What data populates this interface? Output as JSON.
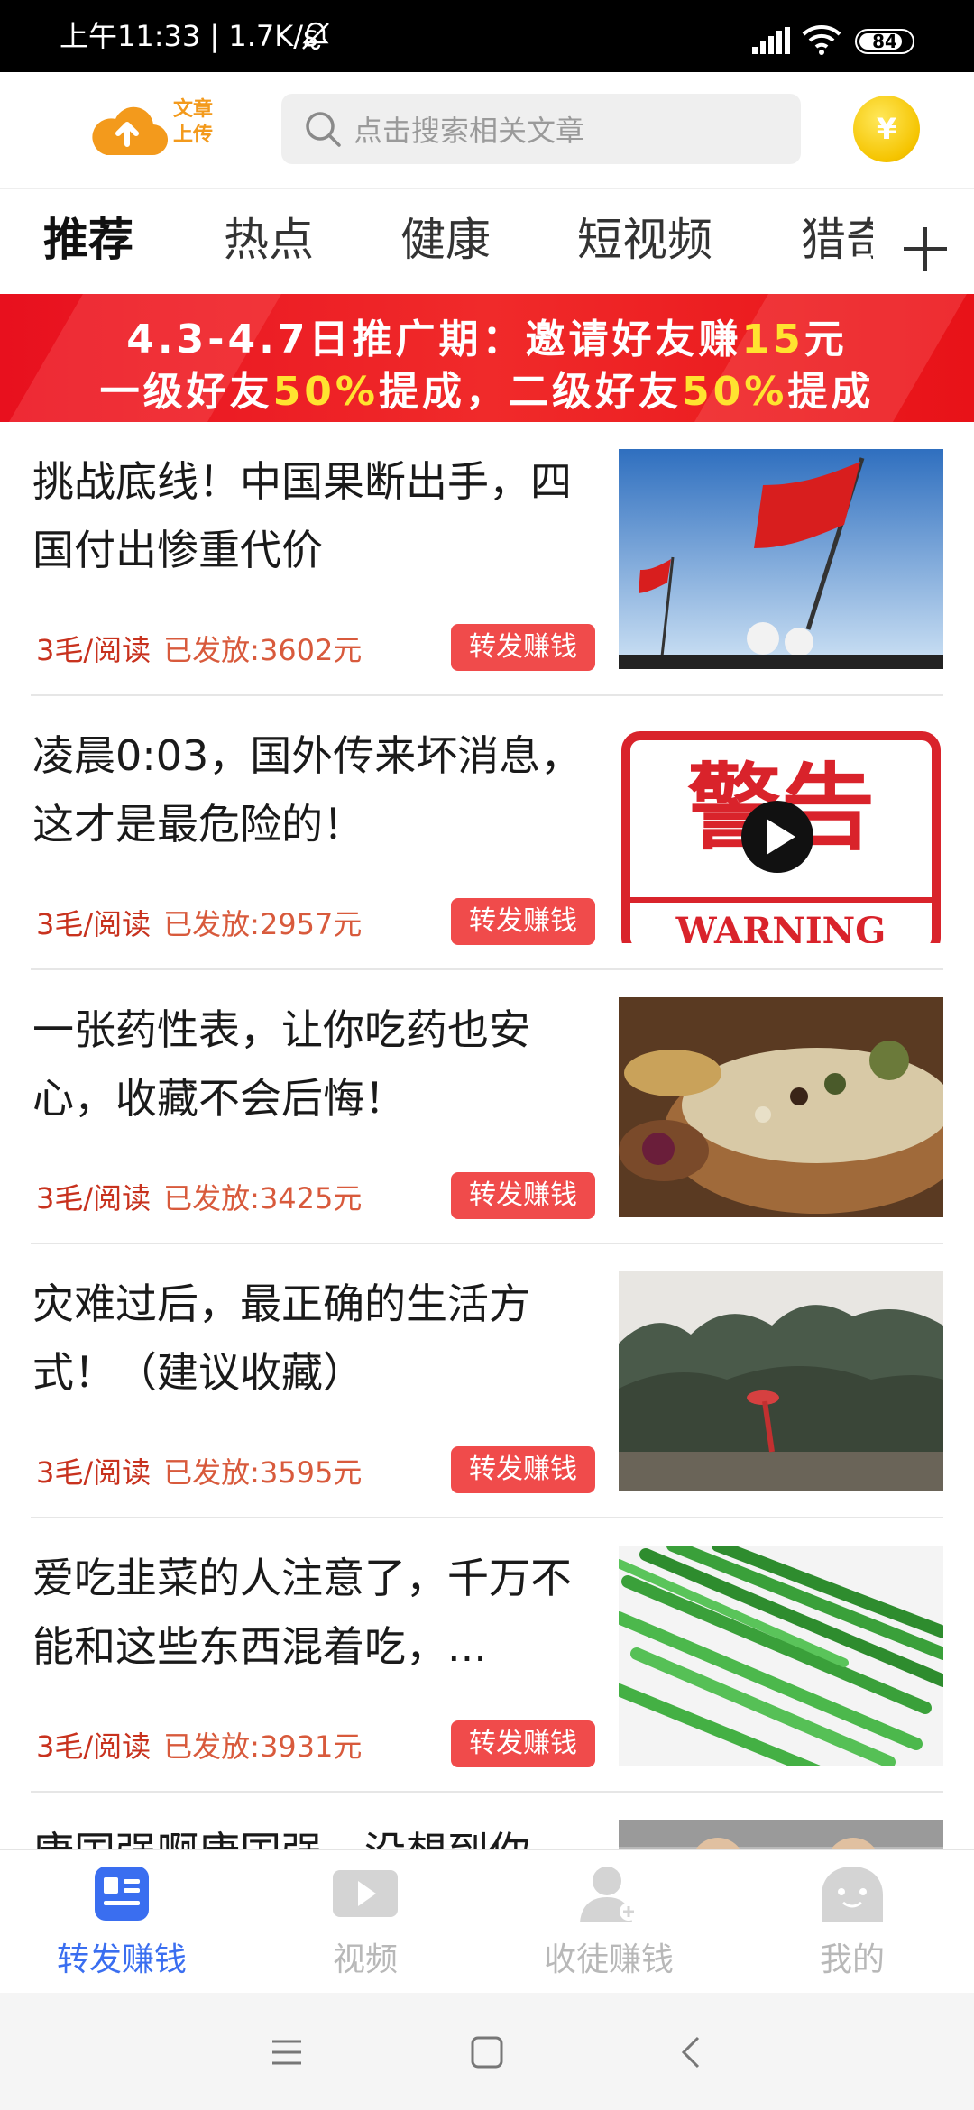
{
  "status_bar": {
    "time_text": "上午11:33 | 1.7K/s",
    "battery": "84",
    "battery_level": 0.84
  },
  "header": {
    "logo_line1": "文章",
    "logo_line2": "上传",
    "search_placeholder": "点击搜索相关文章",
    "coin_symbol": "¥"
  },
  "tabs": [
    {
      "label": "推荐",
      "active": true
    },
    {
      "label": "热点",
      "active": false
    },
    {
      "label": "健康",
      "active": false
    },
    {
      "label": "短视频",
      "active": false
    },
    {
      "label": "猎奇",
      "active": false
    }
  ],
  "banner": {
    "line1_a": "4.3-4.7日推广期：邀请好友赚",
    "line1_b": "15",
    "line1_c": "元",
    "line2_a": "一级好友",
    "line2_b": "50%",
    "line2_c": "提成，二级好友",
    "line2_d": "50%",
    "line2_e": "提成"
  },
  "articles": [
    {
      "title": "挑战底线！中国果断出手，四国付出惨重代价",
      "rate": "3毛/阅读",
      "paid": "已发放:3602元",
      "button": "转发赚钱",
      "thumb": "flag-image"
    },
    {
      "title": "凌晨0:03，国外传来坏消息，这才是最危险的！",
      "rate": "3毛/阅读",
      "paid": "已发放:2957元",
      "button": "转发赚钱",
      "thumb": "warning-video-image",
      "thumb_text_1": "警告",
      "thumb_text_2": "WARNING"
    },
    {
      "title": "一张药性表，让你吃药也安心，收藏不会后悔！",
      "rate": "3毛/阅读",
      "paid": "已发放:3425元",
      "button": "转发赚钱",
      "thumb": "herbs-image"
    },
    {
      "title": "灾难过后，最正确的生活方式！（建议收藏）",
      "rate": "3毛/阅读",
      "paid": "已发放:3595元",
      "button": "转发赚钱",
      "thumb": "forest-umbrella-image"
    },
    {
      "title": "爱吃韭菜的人注意了，千万不能和这些东西混着吃，...",
      "rate": "3毛/阅读",
      "paid": "已发放:3931元",
      "button": "转发赚钱",
      "thumb": "chives-image"
    },
    {
      "title": "康国强啊康国强，没想到你",
      "rate": "",
      "paid": "",
      "button": "",
      "thumb": "people-image"
    }
  ],
  "bottom_nav": [
    {
      "label": "转发赚钱",
      "icon": "article-icon",
      "active": true
    },
    {
      "label": "视频",
      "icon": "video-icon",
      "active": false
    },
    {
      "label": "收徒赚钱",
      "icon": "add-user-icon",
      "active": false
    },
    {
      "label": "我的",
      "icon": "profile-face-icon",
      "active": false
    }
  ],
  "colors": {
    "accent_red": "#f04b4b",
    "nav_active": "#3a6ef0",
    "banner_highlight": "#ffe330",
    "logo_orange": "#f39a1c"
  }
}
